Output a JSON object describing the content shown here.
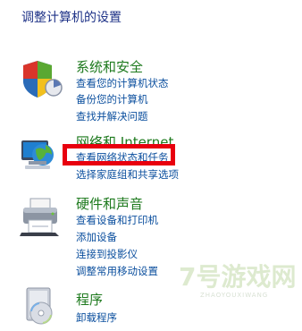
{
  "page_title": "调整计算机的设置",
  "categories": [
    {
      "title": "系统和安全",
      "icon": "shield-icon",
      "links": [
        "查看您的计算机状态",
        "备份您的计算机",
        "查找并解决问题"
      ]
    },
    {
      "title": "网络和 Internet",
      "icon": "network-globe-icon",
      "links": [
        "查看网络状态和任务",
        "选择家庭组和共享选项"
      ]
    },
    {
      "title": "硬件和声音",
      "icon": "printer-icon",
      "links": [
        "查看设备和打印机",
        "添加设备",
        "连接到投影仪",
        "调整常用移动设置"
      ]
    },
    {
      "title": "程序",
      "icon": "programs-icon",
      "links": [
        "卸载程序"
      ]
    }
  ],
  "highlight": {
    "target": "查看网络状态和任务",
    "color": "#e8000e"
  },
  "watermark": {
    "logo": "7号游戏网",
    "sub": "ZHAOYOUXIWANG"
  },
  "colors": {
    "title": "#1e3287",
    "category_title": "#1e7a1e",
    "link": "#0b4f9e"
  }
}
